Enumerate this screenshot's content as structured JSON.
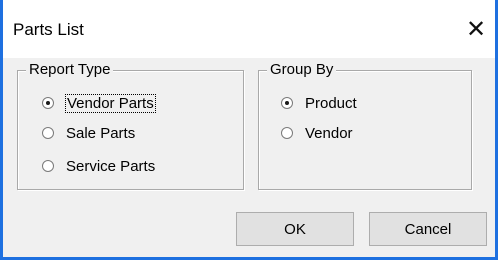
{
  "window": {
    "title": "Parts List",
    "close_glyph": "✕"
  },
  "report_type": {
    "legend": "Report Type",
    "options": [
      {
        "label": "Vendor Parts",
        "selected": true
      },
      {
        "label": "Sale Parts",
        "selected": false
      },
      {
        "label": "Service Parts",
        "selected": false
      }
    ]
  },
  "group_by": {
    "legend": "Group By",
    "options": [
      {
        "label": "Product",
        "selected": true
      },
      {
        "label": "Vendor",
        "selected": false
      }
    ]
  },
  "buttons": {
    "ok_label": "OK",
    "cancel_label": "Cancel"
  },
  "colors": {
    "accent_border": "#1e70e0",
    "dialog_bg": "#f0f0f0"
  }
}
